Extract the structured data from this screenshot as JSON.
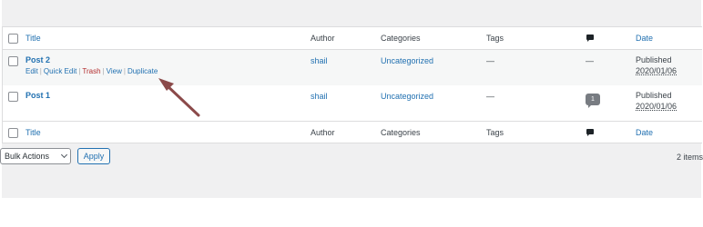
{
  "columns": {
    "title": "Title",
    "author": "Author",
    "categories": "Categories",
    "tags": "Tags",
    "comments_icon": "comment-icon",
    "date": "Date"
  },
  "rows": [
    {
      "title": "Post 2",
      "author": "shail",
      "categories": "Uncategorized",
      "tags": "—",
      "comments": "—",
      "date_status": "Published",
      "date": "2020/01/06",
      "row_actions": {
        "edit": "Edit",
        "quick_edit": "Quick Edit",
        "trash": "Trash",
        "view": "View",
        "duplicate": "Duplicate",
        "separator": "|"
      }
    },
    {
      "title": "Post 1",
      "author": "shail",
      "categories": "Uncategorized",
      "tags": "—",
      "comments": "1",
      "date_status": "Published",
      "date": "2020/01/06"
    }
  ],
  "bulk_actions": {
    "selected": "Bulk Actions",
    "apply_label": "Apply",
    "items_count": "2 items"
  },
  "colors": {
    "link": "#2271b1",
    "trash": "#b32d2e",
    "arrow": "#8b4a4a"
  }
}
